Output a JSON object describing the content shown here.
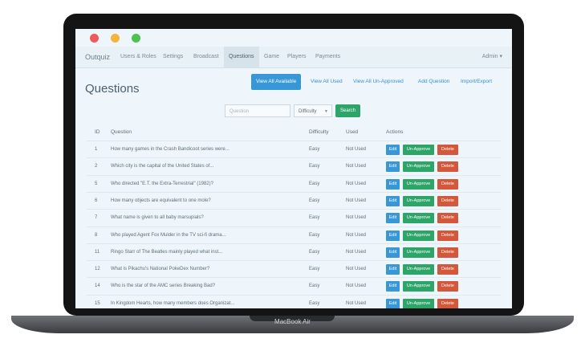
{
  "brand": "Outquiz",
  "nav": [
    "Users & Roles",
    "Settings",
    "Broadcast",
    "Questions",
    "Game",
    "Players",
    "Payments"
  ],
  "nav_active": "Questions",
  "admin_label": "Admin",
  "page_title": "Questions",
  "toolbar": [
    "View All Available",
    "View All Used",
    "View All Un-Approved",
    "Add Question",
    "Import/Export"
  ],
  "filter": {
    "search_placeholder": "Question",
    "difficulty_value": "Difficulty",
    "search_label": "Search"
  },
  "table": {
    "headers": [
      "ID",
      "Question",
      "Difficulty",
      "Used",
      "Actions"
    ],
    "rows": [
      {
        "id": "1",
        "question": "How many games in the Crash Bandicoot series were...",
        "difficulty": "Easy",
        "used": "Not Used"
      },
      {
        "id": "2",
        "question": "Which city is the capital of the United States of...",
        "difficulty": "Easy",
        "used": "Not Used"
      },
      {
        "id": "5",
        "question": "Who directed \"E.T. the Extra-Terrestrial\" (1982)?",
        "difficulty": "Easy",
        "used": "Not Used"
      },
      {
        "id": "6",
        "question": "How many objects are equivalent to one mole?",
        "difficulty": "Easy",
        "used": "Not Used"
      },
      {
        "id": "7",
        "question": "What name is given to all baby marsupials?",
        "difficulty": "Easy",
        "used": "Not Used"
      },
      {
        "id": "8",
        "question": "Who played Agent Fox Mulder in the TV sci-fi drama...",
        "difficulty": "Easy",
        "used": "Not Used"
      },
      {
        "id": "11",
        "question": "Ringo Starr of The Beatles mainly played what inst...",
        "difficulty": "Easy",
        "used": "Not Used"
      },
      {
        "id": "12",
        "question": "What is Pikachu's National PokeDex Number?",
        "difficulty": "Easy",
        "used": "Not Used"
      },
      {
        "id": "14",
        "question": "Who is the star of the AMC series Breaking Bad?",
        "difficulty": "Easy",
        "used": "Not Used"
      },
      {
        "id": "15",
        "question": "In Kingdom Hearts, how many members does Organizat...",
        "difficulty": "Easy",
        "used": "Not Used"
      }
    ]
  },
  "actions": {
    "edit": "Edit",
    "unapprove": "Un-Approve",
    "delete": "Delete"
  },
  "device_label": "MacBook Air",
  "colors": {
    "primary": "#3897d6",
    "success": "#2ea568",
    "danger": "#d3573a"
  }
}
